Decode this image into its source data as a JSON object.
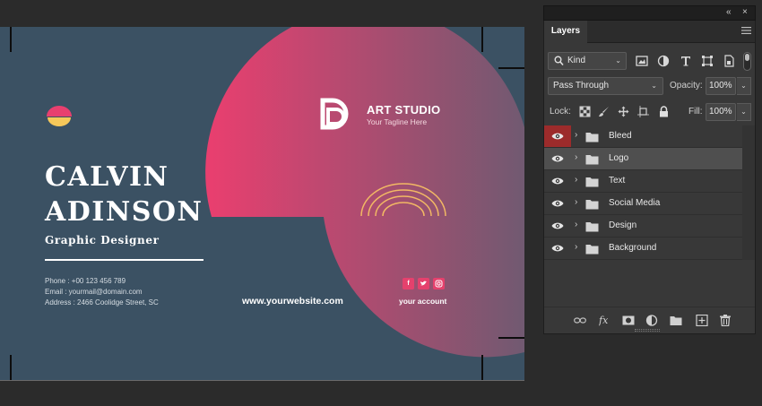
{
  "card": {
    "first_name": "CALVIN",
    "last_name": "ADINSON",
    "job_title": "Graphic Designer",
    "phone": "Phone : +00 123 456 789",
    "email": "Email  : yourmail@domain.com",
    "address": "Address  : 2466 Coolidge Street, SC",
    "website": "www.yourwebsite.com",
    "studio_name": "ART STUDIO",
    "studio_tagline": "Your Tagline Here",
    "account": "your account",
    "colors": {
      "background": "#3b5163",
      "pink": "#e83f6f",
      "mauve": "#6f5a71",
      "yellow": "#f6c85a",
      "arc_gold": "#f2b864"
    }
  },
  "panel": {
    "collapse_glyph": "«",
    "close_glyph": "×",
    "tab_label": "Layers",
    "kind_label": "Kind",
    "blend_mode": "Pass Through",
    "opacity_label": "Opacity:",
    "opacity_value": "100%",
    "lock_label": "Lock:",
    "fill_label": "Fill:",
    "fill_value": "100%",
    "dropdown_glyph": "⌄",
    "row_chevron": "›",
    "layers": [
      {
        "label": "Bleed",
        "selected": false,
        "eye_highlight": true
      },
      {
        "label": "Logo",
        "selected": true,
        "eye_highlight": false
      },
      {
        "label": "Text",
        "selected": false,
        "eye_highlight": false
      },
      {
        "label": "Social Media",
        "selected": false,
        "eye_highlight": false
      },
      {
        "label": "Design",
        "selected": false,
        "eye_highlight": false
      },
      {
        "label": "Background",
        "selected": false,
        "eye_highlight": false
      }
    ],
    "colors": {
      "panel_bg": "#383838",
      "selected_row": "#4f4f4f",
      "eye_highlight": "#9c2b2b"
    }
  }
}
